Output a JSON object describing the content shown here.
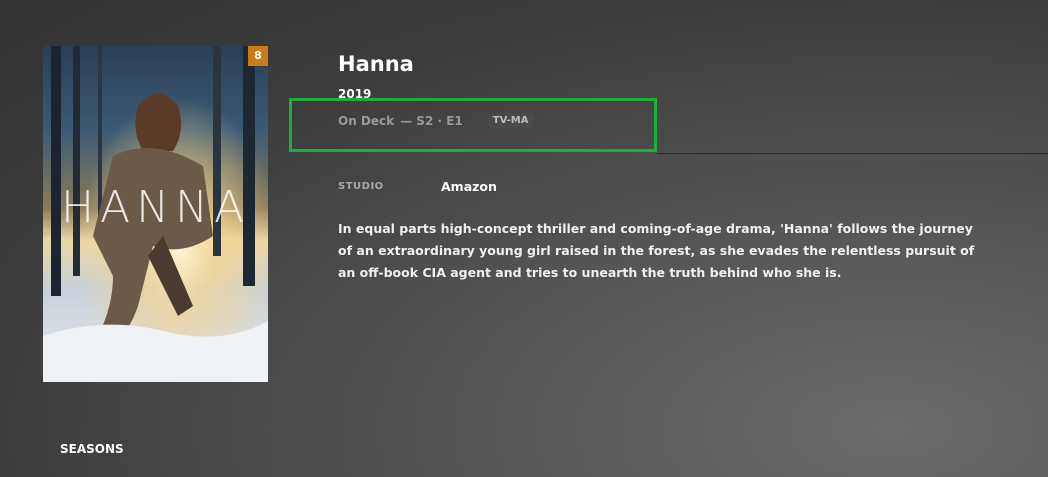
{
  "poster": {
    "badge_count": "8",
    "title_art": "HANNA"
  },
  "show": {
    "title": "Hanna",
    "year": "2019",
    "on_deck_label": "On Deck",
    "episode": "— S2 · E1",
    "content_rating": "TV-MA",
    "studio_label": "STUDIO",
    "studio": "Amazon",
    "summary": "In equal parts high-concept thriller and coming-of-age drama, 'Hanna' follows the journey of an extraordinary young girl raised in the forest, as she evades the relentless pursuit of an off-book CIA agent and tries to unearth the truth behind who she is."
  },
  "sections": {
    "seasons_label": "SEASONS"
  },
  "colors": {
    "badge": "#cc7b19",
    "highlight": "#1fae3e"
  }
}
